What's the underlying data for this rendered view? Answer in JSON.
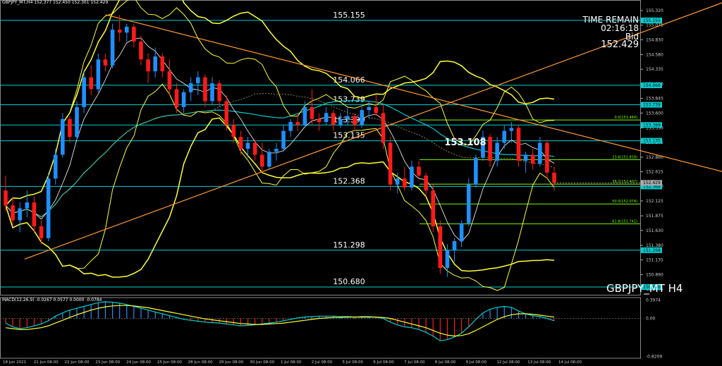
{
  "header": {
    "title": "GBPJPY_MT,H4  152.377 152.450 152.301 152.429"
  },
  "macd_header": "MACD(12,26,9) -0.0267 0.0577 0.0000 -0.0784",
  "timer": {
    "label": "TIME REMAIN",
    "value": "02:16:18",
    "bid_label": "Bid",
    "bid_value": "152.429"
  },
  "symbol_label": "GBPJPY_MT H4",
  "colors": {
    "background": "#000000",
    "bull": "#1e90ff",
    "bear": "#ff1a1a",
    "bands": "#ffff33",
    "ma": "#00ced1",
    "trend": "#ff9933",
    "fib": "#7cfc00",
    "level": "#00ced1"
  },
  "chart_data": {
    "type": "candlestick",
    "price_axis": {
      "range": [
        150.55,
        155.45
      ],
      "ticks": [
        "155.320",
        "155.075",
        "154.830",
        "154.580",
        "154.335",
        "154.090",
        "153.845",
        "153.600",
        "153.350",
        "153.105",
        "152.860",
        "152.615",
        "152.370",
        "152.125",
        "151.875",
        "151.630",
        "151.380",
        "151.135",
        "150.890",
        "150.645"
      ]
    },
    "x_labels": [
      "18 Jun 2021",
      "21 Jun 08:00",
      "22 Jun 08:00",
      "23 Jun 08:00",
      "24 Jun 08:00",
      "25 Jun 08:00",
      "28 Jun 08:00",
      "29 Jun 08:00",
      "30 Jun 08:00",
      "1 Jul 08:00",
      "2 Jul 08:00",
      "5 Jul 08:00",
      "6 Jul 08:00",
      "7 Jul 08:00",
      "8 Jul 08:00",
      "9 Jul 08:00",
      "12 Jul 08:00",
      "13 Jul 08:00",
      "14 Jul 08:00"
    ],
    "levels": [
      {
        "label": "155.155",
        "value": 155.155,
        "axis_label": "155.155"
      },
      {
        "label": "154.066",
        "value": 154.066,
        "axis_label": "154.066"
      },
      {
        "label": "153.739",
        "value": 153.739,
        "axis_label": "153.739"
      },
      {
        "label": "153.399",
        "value": 153.399,
        "axis_label": "153.399"
      },
      {
        "label": "153.135",
        "value": 153.135,
        "axis_label": "153.135"
      },
      {
        "label": "152.368",
        "value": 152.368,
        "axis_label": "152.368"
      },
      {
        "label": "151.298",
        "value": 151.298,
        "axis_label": "151.298"
      },
      {
        "label": "150.680",
        "value": 150.68,
        "axis_label": "150.680"
      }
    ],
    "fib_levels": [
      {
        "label": "0.0(153.484)",
        "value": 153.484
      },
      {
        "label": "23.6(152.818)",
        "value": 152.818
      },
      {
        "label": "38.2(152.407)",
        "value": 152.407
      },
      {
        "label": "50.0(152.074)",
        "value": 152.074
      },
      {
        "label": "61.8(151.741)",
        "value": 151.741
      }
    ],
    "annotation": {
      "label": "153.108",
      "value": 153.108
    },
    "current_price": {
      "label": "152.429",
      "value": 152.429
    },
    "candles": [
      [
        152.3,
        152.55,
        151.95,
        152.05
      ],
      [
        152.05,
        152.2,
        151.7,
        151.8
      ],
      [
        151.8,
        152.1,
        151.6,
        152.0
      ],
      [
        152.0,
        152.3,
        151.85,
        152.1
      ],
      [
        152.1,
        152.2,
        151.6,
        151.7
      ],
      [
        151.7,
        151.8,
        151.4,
        151.5
      ],
      [
        151.5,
        152.6,
        151.45,
        152.5
      ],
      [
        152.5,
        153.0,
        152.4,
        152.9
      ],
      [
        152.9,
        153.6,
        152.85,
        153.5
      ],
      [
        153.5,
        153.55,
        153.1,
        153.2
      ],
      [
        153.2,
        153.8,
        153.15,
        153.7
      ],
      [
        153.7,
        154.3,
        153.6,
        154.2
      ],
      [
        154.2,
        154.4,
        153.9,
        154.0
      ],
      [
        154.0,
        154.6,
        153.95,
        154.5
      ],
      [
        154.5,
        154.6,
        154.3,
        154.4
      ],
      [
        154.4,
        155.1,
        154.35,
        155.0
      ],
      [
        155.0,
        155.25,
        154.8,
        154.95
      ],
      [
        154.95,
        155.1,
        154.8,
        155.05
      ],
      [
        155.05,
        155.1,
        154.7,
        154.8
      ],
      [
        154.8,
        154.9,
        154.4,
        154.5
      ],
      [
        154.5,
        154.6,
        154.1,
        154.3
      ],
      [
        154.3,
        154.7,
        154.2,
        154.55
      ],
      [
        154.55,
        154.6,
        154.2,
        154.3
      ],
      [
        154.3,
        154.5,
        153.9,
        154.0
      ],
      [
        154.0,
        154.1,
        153.6,
        153.7
      ],
      [
        153.7,
        154.0,
        153.6,
        153.95
      ],
      [
        153.95,
        154.2,
        153.8,
        154.1
      ],
      [
        154.1,
        154.3,
        153.9,
        154.2
      ],
      [
        154.2,
        154.25,
        153.7,
        153.8
      ],
      [
        153.8,
        154.2,
        153.75,
        154.1
      ],
      [
        154.1,
        154.15,
        153.7,
        153.8
      ],
      [
        153.8,
        153.9,
        153.3,
        153.4
      ],
      [
        153.4,
        153.5,
        153.1,
        153.2
      ],
      [
        153.2,
        153.3,
        152.9,
        153.0
      ],
      [
        153.0,
        153.2,
        152.85,
        153.1
      ],
      [
        153.1,
        153.15,
        152.8,
        152.9
      ],
      [
        152.9,
        153.1,
        152.6,
        152.7
      ],
      [
        152.7,
        153.0,
        152.65,
        152.95
      ],
      [
        152.95,
        153.1,
        152.8,
        153.0
      ],
      [
        153.0,
        153.4,
        152.95,
        153.3
      ],
      [
        153.3,
        153.5,
        153.2,
        153.45
      ],
      [
        153.45,
        153.6,
        153.3,
        153.4
      ],
      [
        153.4,
        153.8,
        153.35,
        153.7
      ],
      [
        153.7,
        154.0,
        153.4,
        153.5
      ],
      [
        153.5,
        153.6,
        153.3,
        153.45
      ],
      [
        153.45,
        153.7,
        153.4,
        153.6
      ],
      [
        153.6,
        153.65,
        153.3,
        153.4
      ],
      [
        153.4,
        153.6,
        153.35,
        153.5
      ],
      [
        153.5,
        153.7,
        153.4,
        153.55
      ],
      [
        153.55,
        153.6,
        153.3,
        153.4
      ],
      [
        153.4,
        153.7,
        153.35,
        153.65
      ],
      [
        153.65,
        153.8,
        153.5,
        153.7
      ],
      [
        153.7,
        153.9,
        153.55,
        153.6
      ],
      [
        153.6,
        153.75,
        153.0,
        153.1
      ],
      [
        153.1,
        153.2,
        152.3,
        152.4
      ],
      [
        152.4,
        152.6,
        152.25,
        152.5
      ],
      [
        152.5,
        152.7,
        152.3,
        152.35
      ],
      [
        152.35,
        152.8,
        152.3,
        152.7
      ],
      [
        152.7,
        152.8,
        152.5,
        152.55
      ],
      [
        152.55,
        152.6,
        152.2,
        152.3
      ],
      [
        152.3,
        152.4,
        151.6,
        151.7
      ],
      [
        151.7,
        151.8,
        150.9,
        151.0
      ],
      [
        151.0,
        151.4,
        150.85,
        151.3
      ],
      [
        151.3,
        151.5,
        151.1,
        151.45
      ],
      [
        151.45,
        151.8,
        151.35,
        151.75
      ],
      [
        151.75,
        152.5,
        151.7,
        152.4
      ],
      [
        152.4,
        152.9,
        152.35,
        152.85
      ],
      [
        152.85,
        153.3,
        152.8,
        153.2
      ],
      [
        153.2,
        153.25,
        152.7,
        152.8
      ],
      [
        152.8,
        153.2,
        152.7,
        153.1
      ],
      [
        153.1,
        153.4,
        153.0,
        153.3
      ],
      [
        153.3,
        153.45,
        153.1,
        153.35
      ],
      [
        153.35,
        153.4,
        152.7,
        152.8
      ],
      [
        152.8,
        152.95,
        152.6,
        152.9
      ],
      [
        152.9,
        153.0,
        152.65,
        152.75
      ],
      [
        152.75,
        153.2,
        152.7,
        153.1
      ],
      [
        153.1,
        153.15,
        152.5,
        152.6
      ],
      [
        152.6,
        152.7,
        152.3,
        152.43
      ]
    ],
    "macd_axis": {
      "ticks": [
        "0.3974",
        "0.00",
        "-0.8209"
      ],
      "range": [
        -0.86,
        0.45
      ]
    },
    "macd_hist": [
      -0.1,
      -0.18,
      -0.22,
      -0.2,
      -0.16,
      -0.12,
      -0.05,
      0.05,
      0.12,
      0.18,
      0.22,
      0.26,
      0.3,
      0.34,
      0.36,
      0.35,
      0.33,
      0.3,
      0.26,
      0.22,
      0.18,
      0.14,
      0.1,
      0.06,
      0.02,
      -0.02,
      -0.04,
      -0.06,
      -0.08,
      -0.09,
      -0.1,
      -0.12,
      -0.14,
      -0.16,
      -0.15,
      -0.14,
      -0.12,
      -0.1,
      -0.08,
      -0.05,
      -0.02,
      0.01,
      0.03,
      0.04,
      0.05,
      0.05,
      0.05,
      0.04,
      0.04,
      0.03,
      0.04,
      0.04,
      0.03,
      0.0,
      -0.08,
      -0.14,
      -0.18,
      -0.2,
      -0.24,
      -0.3,
      -0.38,
      -0.48,
      -0.46,
      -0.4,
      -0.32,
      -0.18,
      -0.02,
      0.12,
      0.2,
      0.24,
      0.26,
      0.24,
      0.16,
      0.1,
      0.06,
      0.04,
      0.0,
      -0.05
    ],
    "macd_signal": [
      -0.2,
      -0.22,
      -0.24,
      -0.24,
      -0.22,
      -0.2,
      -0.16,
      -0.1,
      -0.04,
      0.02,
      0.08,
      0.13,
      0.18,
      0.22,
      0.25,
      0.27,
      0.28,
      0.28,
      0.27,
      0.25,
      0.23,
      0.2,
      0.17,
      0.14,
      0.11,
      0.08,
      0.05,
      0.02,
      -0.01,
      -0.03,
      -0.05,
      -0.07,
      -0.09,
      -0.11,
      -0.12,
      -0.13,
      -0.13,
      -0.12,
      -0.11,
      -0.1,
      -0.08,
      -0.06,
      -0.04,
      -0.02,
      0.0,
      0.01,
      0.02,
      0.02,
      0.03,
      0.03,
      0.03,
      0.03,
      0.03,
      0.02,
      0.0,
      -0.04,
      -0.08,
      -0.12,
      -0.16,
      -0.2,
      -0.26,
      -0.32,
      -0.36,
      -0.38,
      -0.37,
      -0.33,
      -0.26,
      -0.18,
      -0.1,
      -0.02,
      0.04,
      0.08,
      0.1,
      0.1,
      0.09,
      0.07,
      0.05,
      0.03
    ]
  }
}
